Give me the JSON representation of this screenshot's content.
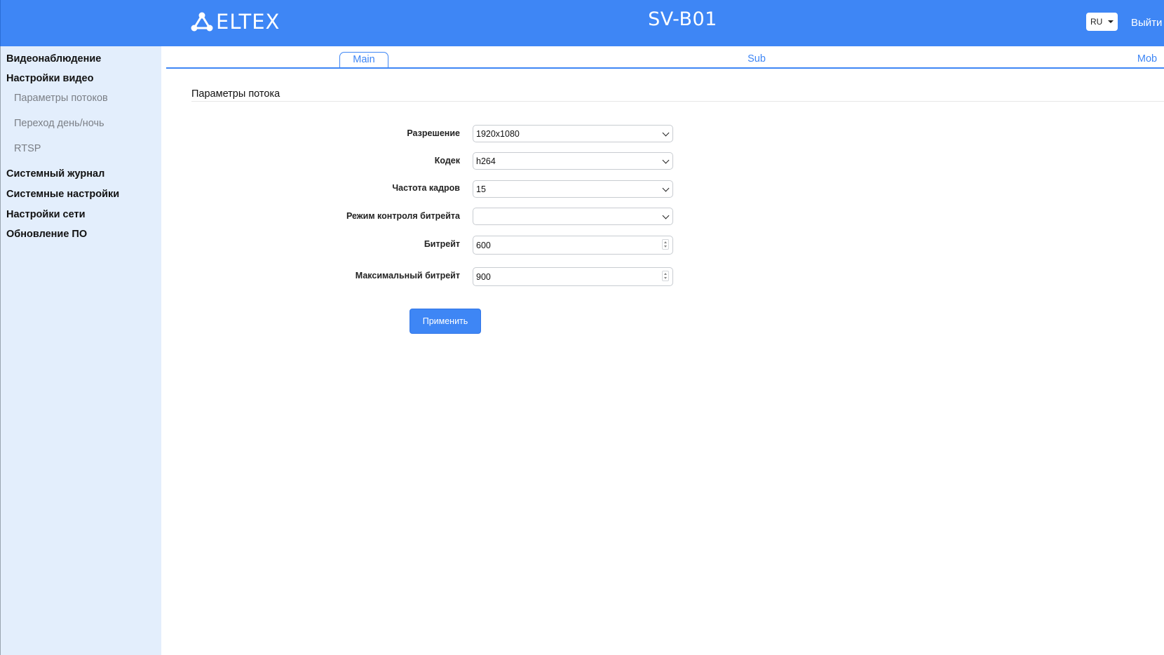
{
  "header": {
    "logo_text": "ELTEX",
    "device_title": "SV-B01",
    "language": "RU",
    "logout_label": "Выйти",
    "brand_color": "#3e86f5"
  },
  "sidebar": {
    "items": [
      {
        "label": "Видеонаблюдение",
        "level": 1
      },
      {
        "label": "Настройки видео",
        "level": 1
      },
      {
        "label": "Параметры потоков",
        "level": 2
      },
      {
        "label": "Переход день/ночь",
        "level": 2
      },
      {
        "label": "RTSP",
        "level": 2
      },
      {
        "label": "Системный журнал",
        "level": 1
      },
      {
        "label": "Системные настройки",
        "level": 1
      },
      {
        "label": "Настройки сети",
        "level": 1
      },
      {
        "label": "Обновление ПО",
        "level": 1
      }
    ]
  },
  "tabs": [
    {
      "label": "Main",
      "active": true
    },
    {
      "label": "Sub",
      "active": false
    },
    {
      "label": "Mob",
      "active": false
    }
  ],
  "section": {
    "title": "Параметры потока"
  },
  "form": {
    "resolution": {
      "label": "Разрешение",
      "value": "1920x1080"
    },
    "codec": {
      "label": "Кодек",
      "value": "h264"
    },
    "framerate": {
      "label": "Частота кадров",
      "value": "15"
    },
    "bitrate_mode": {
      "label": "Режим контроля битрейта",
      "value": ""
    },
    "bitrate": {
      "label": "Битрейт",
      "value": "600"
    },
    "max_bitrate": {
      "label": "Максимальный битрейт",
      "value": "900"
    }
  },
  "apply_label": "Применить",
  "icons": {
    "logo": "eltex-logo-icon",
    "lang_caret": "caret-down-icon",
    "select_chevron": "chevron-down-icon",
    "number_spinner": "spinner-icon"
  }
}
